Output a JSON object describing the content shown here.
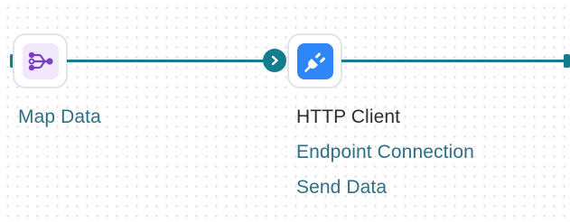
{
  "flow": {
    "connector_color": "#137d8d",
    "nodes": [
      {
        "label": "Map Data",
        "icon": "map-data-icon",
        "icon_bg": "#f1e9fb",
        "icon_color": "#7b3fc4"
      },
      {
        "label": "HTTP Client",
        "icon": "plug-icon",
        "icon_bg": "#2f86f6",
        "icon_color": "#ffffff",
        "sub_items": [
          "Endpoint Connection",
          "Send Data"
        ]
      }
    ],
    "connector_icon": "chevron-right-icon"
  }
}
